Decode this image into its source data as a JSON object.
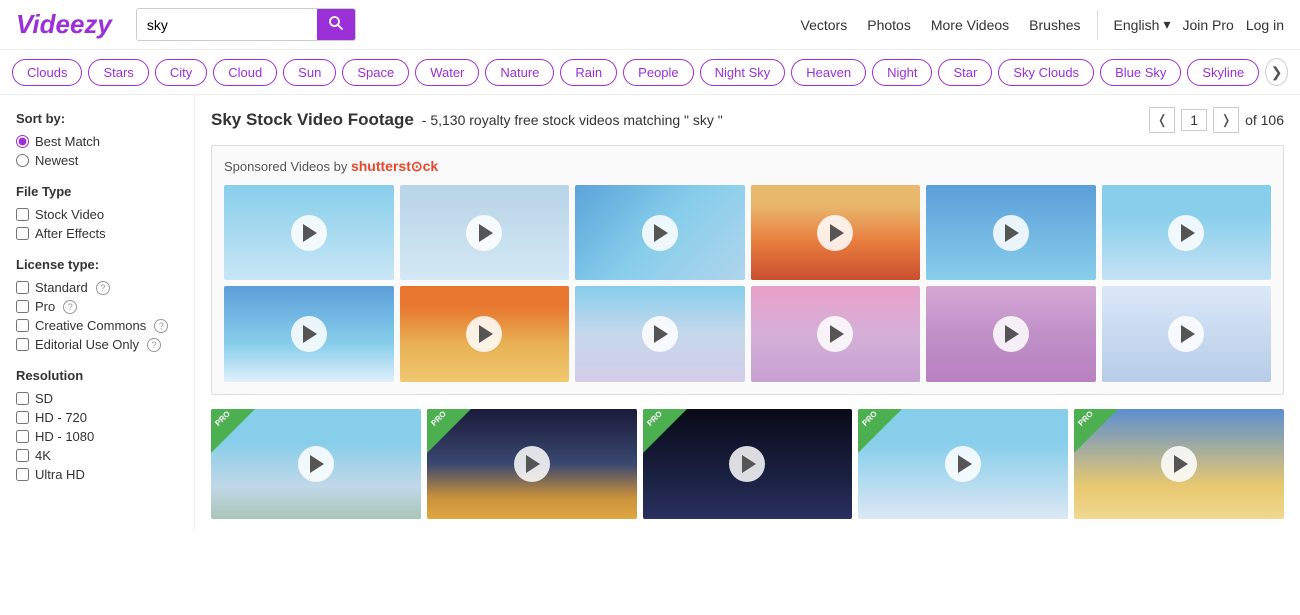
{
  "header": {
    "logo": "Videezy",
    "search": {
      "value": "sky",
      "placeholder": "sky"
    },
    "nav": {
      "vectors": "Vectors",
      "photos": "Photos",
      "more_videos": "More Videos",
      "brushes": "Brushes"
    },
    "lang": "English",
    "join_pro": "Join Pro",
    "log_in": "Log in"
  },
  "tags": [
    "Clouds",
    "Stars",
    "City",
    "Cloud",
    "Sun",
    "Space",
    "Water",
    "Nature",
    "Rain",
    "People",
    "Night Sky",
    "Heaven",
    "Night",
    "Star",
    "Sky Clouds",
    "Blue Sky",
    "Skyline"
  ],
  "sidebar": {
    "sort_label": "Sort by:",
    "sort_options": [
      "Best Match",
      "Newest"
    ],
    "file_type_label": "File Type",
    "file_types": [
      "Stock Video",
      "After Effects"
    ],
    "license_label": "License type:",
    "licenses": [
      {
        "label": "Standard",
        "has_info": true
      },
      {
        "label": "Pro",
        "has_info": true
      },
      {
        "label": "Creative Commons",
        "has_info": true
      },
      {
        "label": "Editorial Use Only",
        "has_info": true
      }
    ],
    "resolution_label": "Resolution",
    "resolutions": [
      "SD",
      "HD - 720",
      "HD - 1080",
      "4K",
      "Ultra HD"
    ]
  },
  "content": {
    "result_title": "Sky Stock Video Footage",
    "result_subtitle": "- 5,130 royalty free stock videos matching \" sky \"",
    "pagination": {
      "current": "1",
      "total": "of 106"
    },
    "sponsored_label": "Sponsored Videos by ",
    "shutterstock_label": "shutterstock"
  },
  "colors": {
    "primary": "#9b30d9",
    "shutterstock_red": "#e8472b",
    "pro_green": "#4caf50"
  }
}
